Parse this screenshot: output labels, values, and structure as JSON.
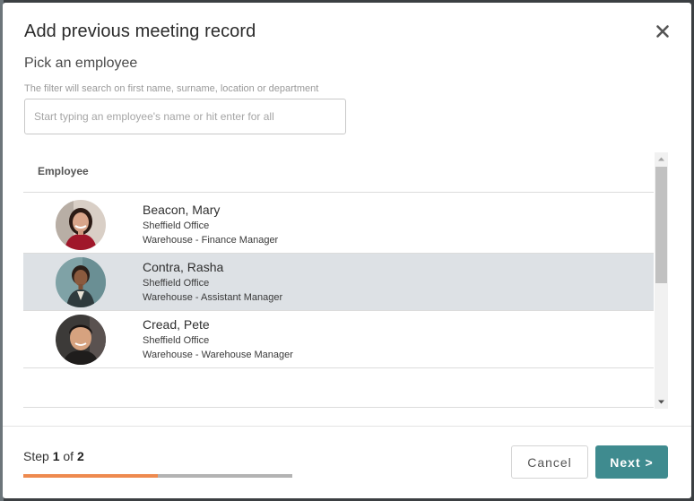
{
  "dialog": {
    "title": "Add previous meeting record",
    "section_title": "Pick an employee",
    "search": {
      "hint": "The filter will search on first name, surname, location or department",
      "placeholder": "Start typing an employee's name or hit enter for all",
      "value": ""
    }
  },
  "table": {
    "header": "Employee",
    "rows": [
      {
        "name": "Beacon, Mary",
        "location": "Sheffield Office",
        "department": "Warehouse - Finance Manager",
        "selected": false,
        "avatar": "woman-red-top-avatar"
      },
      {
        "name": "Contra, Rasha",
        "location": "Sheffield Office",
        "department": "Warehouse - Assistant Manager",
        "selected": true,
        "avatar": "woman-dark-outfit-avatar"
      },
      {
        "name": "Cread, Pete",
        "location": "Sheffield Office",
        "department": "Warehouse - Warehouse Manager",
        "selected": false,
        "avatar": "man-dark-hair-avatar"
      }
    ]
  },
  "footer": {
    "step_prefix": "Step",
    "step_current": "1",
    "step_of": "of",
    "step_total": "2",
    "progress_fraction": 0.5,
    "cancel_label": "Cancel",
    "next_label": "Next >"
  },
  "colors": {
    "accent": "#3f8b8f",
    "progress_fill": "#ee8a4f",
    "progress_track": "#b3b3b3",
    "selected_row": "#dde1e5"
  },
  "icons": {
    "close": "close-icon",
    "scroll_up": "scroll-up-arrow-icon",
    "scroll_down": "scroll-down-arrow-icon"
  }
}
